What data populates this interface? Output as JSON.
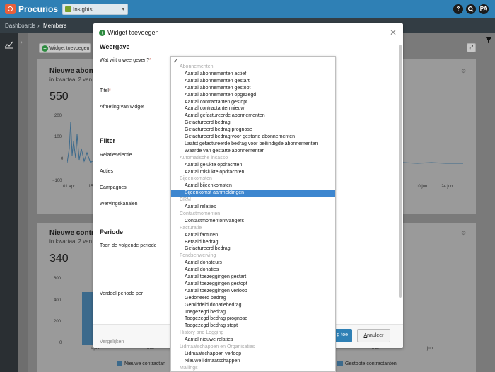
{
  "header": {
    "brand": "Procurios",
    "module": "Insights",
    "help_icon": "?",
    "search_icon": "search",
    "user_initials": "PA"
  },
  "breadcrumb": {
    "root": "Dashboards",
    "separator": "›",
    "current": "Members"
  },
  "dashboard": {
    "add_widget_label": "Widget toevoegen",
    "panel1": {
      "title": "Nieuwe abonne",
      "subtitle": "in kwartaal 2 van",
      "value": "550",
      "y_ticks": [
        "200",
        "100",
        "0",
        "−100"
      ],
      "x_left": "01 apr",
      "x_left2": "15",
      "x_right": [
        "10 jun",
        "24 jun"
      ]
    },
    "panel2": {
      "title": "Nieuwe contrac",
      "subtitle": "in kwartaal 2 van",
      "value": "340",
      "y_ticks": [
        "600",
        "400",
        "200",
        "0"
      ],
      "x_labels": [
        "april",
        "mei",
        "mei",
        "juni"
      ],
      "legend": [
        {
          "label": "Nieuwe contractan",
          "color": "#3c6a8c"
        },
        {
          "label": "Gestopte contractanten",
          "color": "#3c6a8c"
        }
      ]
    }
  },
  "modal": {
    "title": "Widget toevoegen",
    "section_weergave": "Weergave",
    "field_what": "Wat wilt u weergeven?",
    "field_title": "Titel",
    "field_size": "Afmeting van widget",
    "section_filter": "Filter",
    "field_relatieselectie": "Relatieselectie",
    "field_acties": "Acties",
    "field_campagnes": "Campagnes",
    "field_wervingskanalen": "Wervingskanalen",
    "section_periode": "Periode",
    "field_toon": "Toon de volgende periode",
    "field_verdeel": "Verdeel periode per",
    "field_vergelijken": "Vergelijken",
    "primary_button": "g toe",
    "cancel_button_first": "A",
    "cancel_button_rest": "nnuleer"
  },
  "dropdown": {
    "check_mark": "✓",
    "rows": [
      {
        "type": "group",
        "label": "Abonnementen"
      },
      {
        "type": "item",
        "label": "Aantal abonnementen actief"
      },
      {
        "type": "item",
        "label": "Aantal abonnementen gestart"
      },
      {
        "type": "item",
        "label": "Aantal abonnementen gestopt"
      },
      {
        "type": "item",
        "label": "Aantal abonnementen opgezegd"
      },
      {
        "type": "item",
        "label": "Aantal contractanten gestopt"
      },
      {
        "type": "item",
        "label": "Aantal contractanten nieuw"
      },
      {
        "type": "item",
        "label": "Aantal gefactureerde abonnementen"
      },
      {
        "type": "item",
        "label": "Gefactureerd bedrag"
      },
      {
        "type": "item",
        "label": "Gefactureerd bedrag prognose"
      },
      {
        "type": "item",
        "label": "Gefactureerd bedrag voor gestarte abonnementen"
      },
      {
        "type": "item",
        "label": "Laatst gefactureerde bedrag voor beëindigde abonnementen"
      },
      {
        "type": "item",
        "label": "Waarde van gestarte abonnementen"
      },
      {
        "type": "group",
        "label": "Automatische incasso"
      },
      {
        "type": "item",
        "label": "Aantal gelukte opdrachten"
      },
      {
        "type": "item",
        "label": "Aantal mislukte opdrachten"
      },
      {
        "type": "group",
        "label": "Bijeenkomsten"
      },
      {
        "type": "item",
        "label": "Aantal bijeenkomsten"
      },
      {
        "type": "item",
        "label": "Bijeenkomst aanmeldingen",
        "selected": true
      },
      {
        "type": "group",
        "label": "CRM"
      },
      {
        "type": "item",
        "label": "Aantal relaties"
      },
      {
        "type": "group",
        "label": "Contactmomenten"
      },
      {
        "type": "item",
        "label": "Contactmomentontvangers"
      },
      {
        "type": "group",
        "label": "Facturatie"
      },
      {
        "type": "item",
        "label": "Aantal facturen"
      },
      {
        "type": "item",
        "label": "Betaald bedrag"
      },
      {
        "type": "item",
        "label": "Gefactureerd bedrag"
      },
      {
        "type": "group",
        "label": "Fondsenwerving"
      },
      {
        "type": "item",
        "label": "Aantal donateurs"
      },
      {
        "type": "item",
        "label": "Aantal donaties"
      },
      {
        "type": "item",
        "label": "Aantal toezeggingen gestart"
      },
      {
        "type": "item",
        "label": "Aantal toezeggingen gestopt"
      },
      {
        "type": "item",
        "label": "Aantal toezeggingen verloop"
      },
      {
        "type": "item",
        "label": "Gedoneerd bedrag"
      },
      {
        "type": "item",
        "label": "Gemiddeld donatiebedrag"
      },
      {
        "type": "item",
        "label": "Toegezegd bedrag"
      },
      {
        "type": "item",
        "label": "Toegezegd bedrag prognose"
      },
      {
        "type": "item",
        "label": "Toegezegd bedrag stopt"
      },
      {
        "type": "group",
        "label": "History and Logging"
      },
      {
        "type": "item",
        "label": "Aantal nieuwe relaties"
      },
      {
        "type": "group",
        "label": "Lidmaatschappen en Organisaties"
      },
      {
        "type": "item",
        "label": "Lidmaatschappen verloop"
      },
      {
        "type": "item",
        "label": "Nieuwe lidmaatschappen"
      },
      {
        "type": "group",
        "label": "Mailings"
      }
    ]
  }
}
